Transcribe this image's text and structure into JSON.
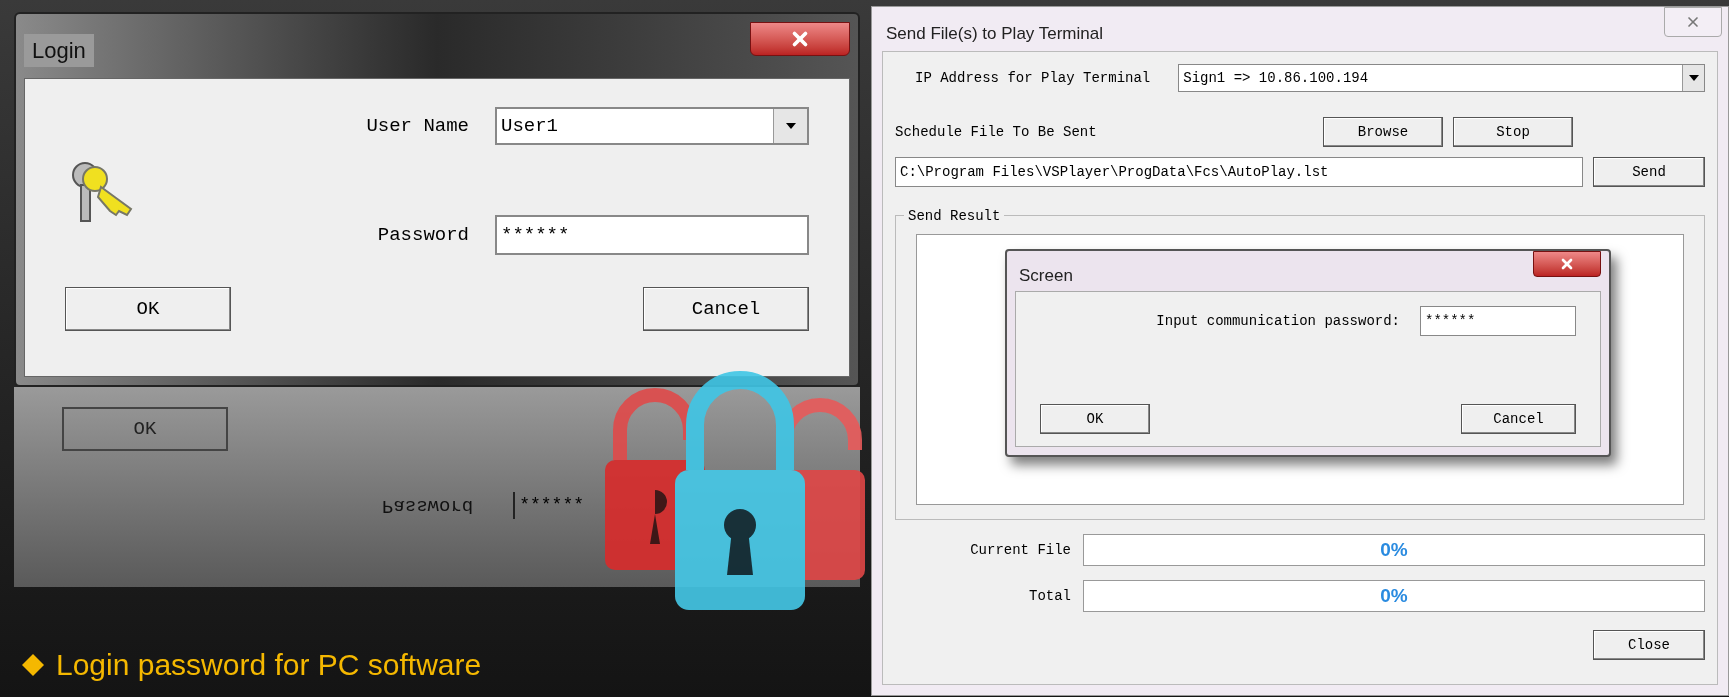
{
  "login_window": {
    "title": "Login",
    "user_name": {
      "label": "User Name",
      "value": "User1"
    },
    "password": {
      "label": "Password",
      "value": "******"
    },
    "buttons": [
      {
        "label": "OK"
      },
      {
        "label": "Cancel"
      }
    ]
  },
  "reflection": {
    "ok": "OK",
    "password_label": "Password",
    "password": "******"
  },
  "send_window": {
    "title": "Send File(s) to Play Terminal",
    "ip": {
      "label": "IP Address for Play Terminal",
      "value": "Sign1 => 10.86.100.194"
    },
    "schedule": {
      "label": "Schedule File To Be Sent",
      "browse": "Browse",
      "stop": "Stop",
      "path": "C:\\Program Files\\VSPlayer\\ProgData\\Fcs\\AutoPlay.lst",
      "send": "Send"
    },
    "result_group": "Send Result",
    "screen_dialog": {
      "title": "Screen",
      "label": "Input communication password:",
      "value": "******",
      "ok": "OK",
      "cancel": "Cancel"
    },
    "progress": [
      {
        "label": "Current File",
        "level": 0,
        "reading": "0%"
      },
      {
        "label": "Total",
        "level": 0,
        "reading": "0%"
      }
    ],
    "close": "Close"
  },
  "caption": {
    "text": "Login password for PC software"
  }
}
